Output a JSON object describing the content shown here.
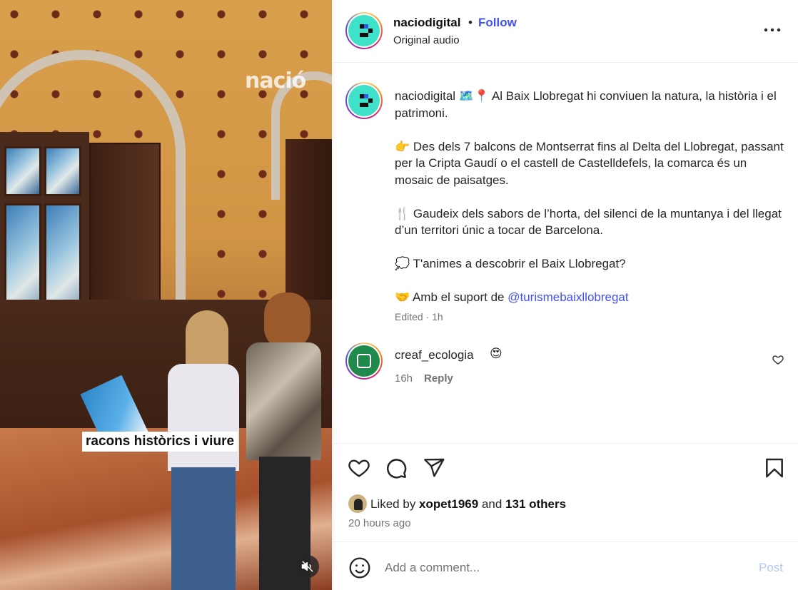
{
  "media": {
    "logo": "nació",
    "caption": "racons històrics i viure",
    "mute_icon": "muted-speaker-icon"
  },
  "header": {
    "username": "naciodigital",
    "separator": "•",
    "follow_label": "Follow",
    "audio_label": "Original audio",
    "more_icon": "more-horizontal-icon"
  },
  "post_caption": {
    "username": "naciodigital",
    "paragraphs": [
      {
        "emoji": "🗺️📍",
        "text": "Al Baix Llobregat hi conviuen la natura, la història i el patrimoni."
      },
      {
        "emoji": "👉",
        "text": "Des dels 7 balcons de Montserrat fins al Delta del Llobregat, passant per la Cripta Gaudí o el castell de Castelldefels, la comarca és un mosaic de paisatges."
      },
      {
        "emoji": "🍴",
        "text": "Gaudeix dels sabors de l’horta, del silenci de la muntanya i del llegat d’un territori únic a tocar de Barcelona."
      },
      {
        "emoji": "💭",
        "text": "T'animes a descobrir el Baix Llobregat?"
      },
      {
        "emoji": "🤝",
        "text": "Amb el suport de ",
        "mention": "@turismebaixllobregat"
      }
    ],
    "meta": "Edited · 1h"
  },
  "comment": {
    "username": "creaf_ecologia",
    "emoji": "😍",
    "time": "16h",
    "reply_label": "Reply"
  },
  "actions": {
    "like_icon": "heart-icon",
    "comment_icon": "comment-icon",
    "share_icon": "share-icon",
    "save_icon": "bookmark-icon"
  },
  "likes": {
    "prefix": "Liked by ",
    "user": "xopet1969",
    "middle": " and ",
    "others": "131 others",
    "time": "20 hours ago"
  },
  "add_comment": {
    "placeholder": "Add a comment...",
    "post_label": "Post"
  },
  "colors": {
    "accent": "#4150f7",
    "post_disabled": "#b3c8f8",
    "muted_text": "#737373",
    "avatar_bg": "#3fe1c8"
  }
}
